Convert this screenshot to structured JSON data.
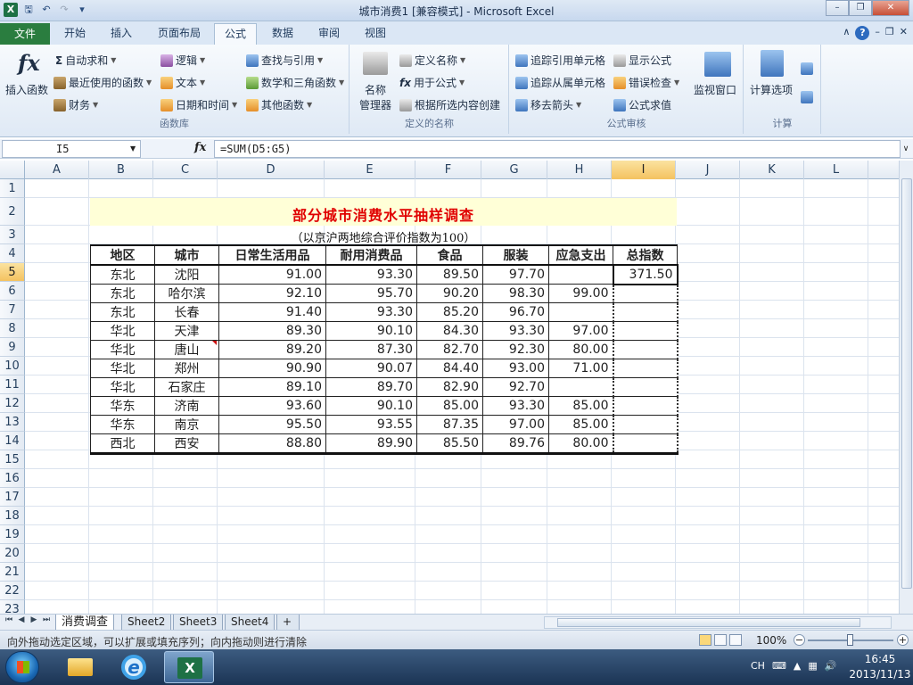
{
  "window": {
    "title": "城市消费1 [兼容模式] - Microsoft Excel"
  },
  "ribbon_tabs": {
    "file": "文件",
    "tabs": [
      "开始",
      "插入",
      "页面布局",
      "公式",
      "数据",
      "审阅",
      "视图"
    ],
    "active": "公式"
  },
  "ribbon": {
    "function_library": {
      "insert_function": "插入函数",
      "autosum": "自动求和",
      "recent": "最近使用的函数",
      "financial": "财务",
      "logical": "逻辑",
      "text": "文本",
      "datetime": "日期和时间",
      "lookup": "查找与引用",
      "math": "数学和三角函数",
      "more": "其他函数",
      "label": "函数库"
    },
    "defined_names": {
      "name_manager_1": "名称",
      "name_manager_2": "管理器",
      "define_name": "定义名称",
      "use_in_formula": "用于公式",
      "create_from_selection": "根据所选内容创建",
      "label": "定义的名称"
    },
    "formula_auditing": {
      "trace_precedents": "追踪引用单元格",
      "trace_dependents": "追踪从属单元格",
      "remove_arrows": "移去箭头",
      "show_formulas": "显示公式",
      "error_checking": "错误检查",
      "evaluate_formula": "公式求值",
      "watch_window": "监视窗口",
      "label": "公式审核"
    },
    "calculation": {
      "calc_options": "计算选项",
      "label": "计算"
    }
  },
  "formula_bar": {
    "name_box": "I5",
    "fx": "fx",
    "formula": "=SUM(D5:G5)"
  },
  "sheet": {
    "columns": [
      "A",
      "B",
      "C",
      "D",
      "E",
      "F",
      "G",
      "H",
      "I",
      "J",
      "K",
      "L"
    ],
    "selected_column": "I",
    "rows": [
      "1",
      "2",
      "3",
      "4",
      "5",
      "6",
      "7",
      "8",
      "9",
      "10",
      "11",
      "12",
      "13",
      "14",
      "15",
      "16",
      "17",
      "18",
      "19",
      "20",
      "21",
      "22",
      "23"
    ],
    "selected_row": "5",
    "report_title": "部分城市消费水平抽样调查",
    "report_subtitle": "（以京沪两地综合评价指数为100）",
    "headers": [
      "地区",
      "城市",
      "日常生活用品",
      "耐用消费品",
      "食品",
      "服装",
      "应急支出",
      "总指数"
    ],
    "data": [
      [
        "东北",
        "沈阳",
        "91.00",
        "93.30",
        "89.50",
        "97.70",
        "",
        "371.50"
      ],
      [
        "东北",
        "哈尔滨",
        "92.10",
        "95.70",
        "90.20",
        "98.30",
        "99.00",
        ""
      ],
      [
        "东北",
        "长春",
        "91.40",
        "93.30",
        "85.20",
        "96.70",
        "",
        ""
      ],
      [
        "华北",
        "天津",
        "89.30",
        "90.10",
        "84.30",
        "93.30",
        "97.00",
        ""
      ],
      [
        "华北",
        "唐山",
        "89.20",
        "87.30",
        "82.70",
        "92.30",
        "80.00",
        ""
      ],
      [
        "华北",
        "郑州",
        "90.90",
        "90.07",
        "84.40",
        "93.00",
        "71.00",
        ""
      ],
      [
        "华北",
        "石家庄",
        "89.10",
        "89.70",
        "82.90",
        "92.70",
        "",
        ""
      ],
      [
        "华东",
        "济南",
        "93.60",
        "90.10",
        "85.00",
        "93.30",
        "85.00",
        ""
      ],
      [
        "华东",
        "南京",
        "95.50",
        "93.55",
        "87.35",
        "97.00",
        "85.00",
        ""
      ],
      [
        "西北",
        "西安",
        "88.80",
        "89.90",
        "85.50",
        "89.76",
        "80.00",
        ""
      ]
    ]
  },
  "sheet_tabs": [
    "消费调查",
    "Sheet2",
    "Sheet3",
    "Sheet4"
  ],
  "status_bar": {
    "message": "向外拖动选定区域，可以扩展或填充序列；向内拖动则进行清除",
    "zoom": "100%"
  },
  "taskbar": {
    "lang": "CH",
    "time": "16:45",
    "date": "2013/11/13"
  },
  "colors": {
    "title_red": "#e00000",
    "title_band": "#ffffd7",
    "selection_header": "#f4c260",
    "excel_green": "#1e7145"
  }
}
